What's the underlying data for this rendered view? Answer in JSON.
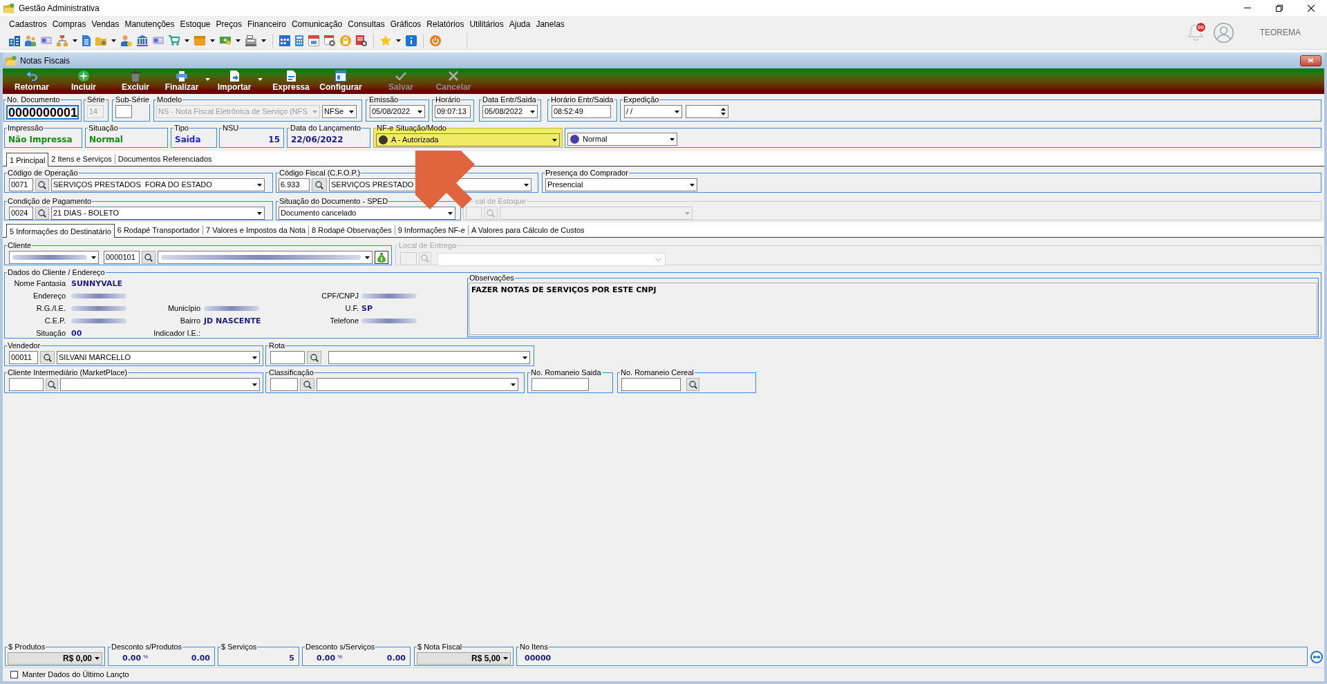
{
  "app": {
    "title": "Gestão Administrativa",
    "notification_count": "00",
    "user": "TEOREMA"
  },
  "menu": [
    "Cadastros",
    "Compras",
    "Vendas",
    "Manutenções",
    "Estoque",
    "Preços",
    "Financeiro",
    "Comunicação",
    "Consultas",
    "Gráficos",
    "Relatórios",
    "Utilitários",
    "Ajuda",
    "Janelas"
  ],
  "window": {
    "title": "Notas Fiscais"
  },
  "toolbar": [
    {
      "label": "Retornar",
      "disabled": false,
      "has_menu": false
    },
    {
      "label": "Incluir",
      "disabled": false,
      "has_menu": false
    },
    {
      "label": "Excluir",
      "disabled": false,
      "has_menu": false
    },
    {
      "label": "Finalizar",
      "disabled": false,
      "has_menu": true
    },
    {
      "label": "Importar",
      "disabled": false,
      "has_menu": true
    },
    {
      "label": "Expressa",
      "disabled": false,
      "has_menu": false
    },
    {
      "label": "Configurar",
      "disabled": false,
      "has_menu": false
    },
    {
      "label": "Salvar",
      "disabled": true,
      "has_menu": false
    },
    {
      "label": "Cancelar",
      "disabled": true,
      "has_menu": false
    }
  ],
  "header": [
    {
      "label": "No. Documento",
      "disabled": false,
      "controls": [
        {
          "kind": "document_number",
          "value": "0000000001",
          "disabled": false
        }
      ]
    },
    {
      "label": "Série",
      "disabled": false,
      "controls": [
        {
          "kind": "text",
          "value": "14",
          "disabled": true
        }
      ]
    },
    {
      "label": "Sub-Série",
      "disabled": false,
      "controls": [
        {
          "kind": "text",
          "disabled": false
        }
      ]
    },
    {
      "label": "Modelo",
      "disabled": false,
      "controls": [
        {
          "kind": "dropdown",
          "value": "NS - Nota Fiscal Eletrônica de Serviço (NFS",
          "disabled": true
        },
        {
          "kind": "dropdown",
          "value": "NFSe",
          "disabled": false
        }
      ]
    },
    {
      "label": "Emissão",
      "disabled": false,
      "controls": [
        {
          "kind": "dropdown",
          "value": "05/08/2022",
          "disabled": false
        }
      ]
    },
    {
      "label": "Horário",
      "disabled": false,
      "controls": [
        {
          "kind": "text",
          "value": "09:07:13",
          "disabled": false
        }
      ]
    },
    {
      "label": "Data Entr/Saida",
      "disabled": false,
      "controls": [
        {
          "kind": "dropdown",
          "value": "05/08/2022",
          "disabled": false
        }
      ]
    },
    {
      "label": "Horário Entr/Saida",
      "disabled": false,
      "controls": [
        {
          "kind": "text",
          "value": "08:52:49",
          "disabled": false
        }
      ]
    },
    {
      "label": "Expedição",
      "disabled": false,
      "controls": [
        {
          "kind": "dropdown",
          "value": "/ /",
          "disabled": false
        },
        {
          "kind": "spin",
          "disabled": false
        }
      ]
    }
  ],
  "status": [
    {
      "label": "Impressão",
      "kind": "text",
      "value": "Não Impressa",
      "color": "#138c13"
    },
    {
      "label": "Situação",
      "kind": "text",
      "value": "Normal",
      "color": "#138c13"
    },
    {
      "label": "Tipo",
      "kind": "text",
      "value": "Saida",
      "color": "#2424e6"
    },
    {
      "label": "NSU",
      "kind": "number",
      "value": "15",
      "color": "#1c1c8c"
    },
    {
      "label": "Data do Lançamento",
      "kind": "text",
      "value": "22/06/2022",
      "color": "#1c1c8c"
    }
  ],
  "nfe_status": [
    {
      "label": "NF-e Situação/Modo",
      "highlighted": true,
      "arrow": true,
      "value": "A - Autorizada",
      "color": "#3d3529"
    },
    {
      "highlighted": false,
      "arrow": false,
      "value": "Normal",
      "color": "#4a3da8"
    }
  ],
  "tabs": [
    {
      "label": "1 Principal",
      "selected": true
    },
    {
      "label": "2 Itens e Serviços",
      "selected": false
    },
    {
      "label": "Documentos Referenciados",
      "selected": false
    }
  ],
  "principal": [
    [
      {
        "label": "Código de Operação",
        "disabled": false,
        "controls": [
          {
            "kind": "text",
            "value": "0071",
            "disabled": false
          },
          {
            "kind": "search",
            "disabled": false
          },
          {
            "kind": "dropdown",
            "value": "SERVIÇOS PRESTADOS  FORA DO ESTADO",
            "disabled": false
          }
        ]
      },
      {
        "label": "Código Fiscal (C.F.O.P.)",
        "disabled": false,
        "controls": [
          {
            "kind": "text",
            "value": "6.933",
            "disabled": false
          },
          {
            "kind": "search",
            "disabled": false
          },
          {
            "kind": "dropdown",
            "value": "SERVIÇOS PRESTADO",
            "disabled": false
          }
        ]
      },
      {
        "label": "Presença do Comprador",
        "disabled": false,
        "controls": [
          {
            "kind": "dropdown",
            "value": "Presencial",
            "disabled": false
          }
        ]
      }
    ],
    [
      {
        "label": "Condição de Pagamento",
        "disabled": false,
        "controls": [
          {
            "kind": "text",
            "value": "0024",
            "disabled": false
          },
          {
            "kind": "search",
            "disabled": false
          },
          {
            "kind": "dropdown",
            "value": "21 DIAS - BOLETO",
            "disabled": false
          }
        ]
      },
      {
        "label": "Situação do Documento - SPED",
        "disabled": false,
        "controls": [
          {
            "kind": "dropdown",
            "value": "Documento cancelado",
            "disabled": false
          }
        ]
      },
      {
        "label": "cal de Estoque",
        "disabled": true,
        "controls": [
          {
            "kind": "text",
            "disabled": true
          },
          {
            "kind": "search",
            "disabled": true
          },
          {
            "kind": "dropdown",
            "disabled": true
          }
        ]
      }
    ]
  ],
  "detail_tabs": [
    {
      "label": "5 Informações do Destinatário",
      "selected": true
    },
    {
      "label": "6 Rodapé Transportador",
      "selected": false
    },
    {
      "label": "7 Valores e Impostos da Nota",
      "selected": false
    },
    {
      "label": "8 Rodapé Observações",
      "selected": false
    },
    {
      "label": "9 Informações NF-e",
      "selected": false
    },
    {
      "label": "A Valores para Cálculo de Custos",
      "selected": false
    }
  ],
  "client": [
    {
      "label": "Cliente",
      "disabled": false,
      "controls": [
        {
          "kind": "redacted_dropdown",
          "disabled": false
        },
        {
          "kind": "text",
          "value": "0000101",
          "disabled": false
        },
        {
          "kind": "search",
          "disabled": false
        },
        {
          "kind": "redacted_dropdown",
          "disabled": false
        },
        {
          "kind": "action",
          "disabled": false
        }
      ]
    },
    {
      "label": "Local de Entrega",
      "disabled": true,
      "controls": [
        {
          "kind": "text",
          "disabled": true
        },
        {
          "kind": "search",
          "disabled": true
        },
        {
          "kind": "list_dropdown",
          "disabled": true
        }
      ]
    }
  ],
  "client_data": {
    "label": "Dados do Cliente / Endereço",
    "columns": [
      [
        {
          "label": "Nome Fantasia",
          "kind": "text",
          "value": "SUNNYVALE"
        },
        {
          "label": "Endereço",
          "kind": "redacted"
        },
        {
          "label": "R.G./I.E.",
          "kind": "redacted"
        },
        {
          "label": "C.E.P.",
          "kind": "redacted"
        },
        {
          "label": "Situação",
          "kind": "text",
          "value": "00"
        }
      ],
      [
        {
          "label": "Município",
          "kind": "redacted"
        },
        {
          "label": "Bairro",
          "kind": "text",
          "value": "JD NASCENTE"
        },
        {
          "label": "Indicador I.E.:",
          "kind": "empty"
        }
      ],
      [
        {
          "label": "CPF/CNPJ",
          "kind": "redacted"
        },
        {
          "label": "U.F.",
          "kind": "text",
          "value": "SP"
        },
        {
          "label": "Telefone",
          "kind": "redacted"
        }
      ]
    ]
  },
  "observations": {
    "label": "Observações",
    "text": "FAZER NOTAS DE SERVIÇOS POR ESTE CNPJ"
  },
  "destinatario": [
    [
      {
        "label": "Vendedor",
        "disabled": false,
        "controls": [
          {
            "kind": "text",
            "value": "00011",
            "disabled": false
          },
          {
            "kind": "search",
            "disabled": false
          },
          {
            "kind": "dropdown",
            "value": "SILVANI MARCELLO",
            "disabled": false
          }
        ]
      },
      {
        "label": "Rota",
        "disabled": false,
        "controls": [
          {
            "kind": "text",
            "disabled": false
          },
          {
            "kind": "search",
            "disabled": false
          },
          {
            "kind": "dropdown",
            "disabled": false
          }
        ]
      }
    ],
    [
      {
        "label": "Cliente Intermediário (MarketPlace)",
        "disabled": false,
        "controls": [
          {
            "kind": "text",
            "disabled": false
          },
          {
            "kind": "search",
            "disabled": false
          },
          {
            "kind": "dropdown",
            "disabled": false
          }
        ]
      },
      {
        "label": "Classificação",
        "disabled": false,
        "controls": [
          {
            "kind": "text",
            "disabled": false
          },
          {
            "kind": "search",
            "disabled": false
          },
          {
            "kind": "dropdown",
            "disabled": false
          }
        ]
      },
      {
        "label": "No. Romaneio Saida",
        "disabled": false,
        "controls": [
          {
            "kind": "text",
            "disabled": false
          }
        ]
      },
      {
        "label": "No. Romaneio Cereal",
        "disabled": false,
        "controls": [
          {
            "kind": "text",
            "disabled": false
          },
          {
            "kind": "search",
            "disabled": false
          }
        ]
      }
    ]
  ],
  "totals": [
    {
      "label": "$ Produtos",
      "kind": "money_dropdown",
      "value": "R$ 0,00"
    },
    {
      "label": "Desconto s/Produtos",
      "kind": "discount",
      "percent": "0.00",
      "unit": "%",
      "value": "0.00"
    },
    {
      "label": "$ Serviços",
      "kind": "amount",
      "value": "5"
    },
    {
      "label": "Desconto s/Serviços",
      "kind": "discount",
      "percent": "0.00",
      "unit": "%",
      "value": "0.00"
    },
    {
      "label": "$ Nota Fiscal",
      "kind": "money_dropdown",
      "value": "R$ 5,00"
    },
    {
      "label": "No Itens",
      "kind": "count",
      "value": "00000"
    }
  ],
  "keep_last_entry": {
    "label": "Manter Dados do Último Lançto",
    "checked": false
  }
}
